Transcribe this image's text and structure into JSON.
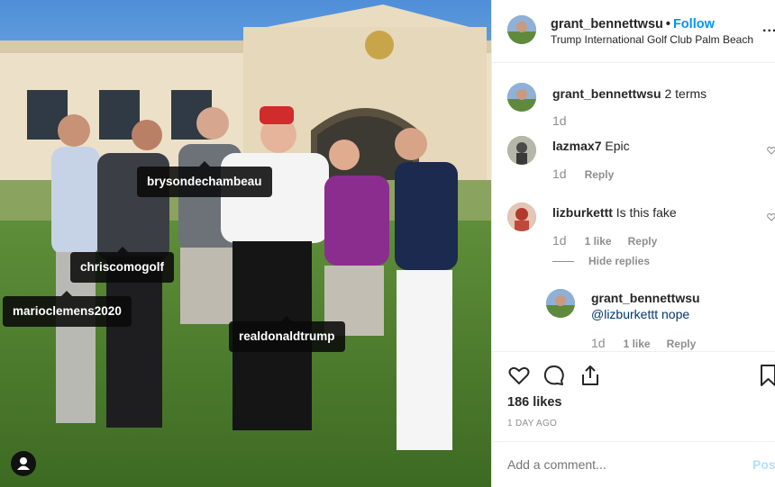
{
  "post": {
    "username": "grant_bennettwsu",
    "dot": "•",
    "follow_label": "Follow",
    "location": "Trump International Golf Club Palm Beach",
    "more_label": "..."
  },
  "photo": {
    "tags": [
      "brysondechambeau",
      "chriscomogolf",
      "marioclemens2020",
      "realdonaldtrump"
    ]
  },
  "comments": [
    {
      "username": "grant_bennettwsu",
      "text": "2 terms",
      "time": "1d"
    },
    {
      "username": "lazmax7",
      "text": "Epic",
      "time": "1d",
      "reply": "Reply"
    },
    {
      "username": "lizburkettt",
      "text": "Is this fake",
      "time": "1d",
      "likes": "1 like",
      "reply": "Reply",
      "hide_replies": "Hide replies"
    }
  ],
  "reply": {
    "username": "grant_bennettwsu",
    "text": "@lizburkettt nope",
    "time": "1d",
    "likes": "1 like",
    "reply": "Reply"
  },
  "likes_count": "186 likes",
  "post_date": "1 DAY AGO",
  "add_comment": {
    "placeholder": "Add a comment...",
    "post_label": "Post"
  },
  "icons": [
    "heart-icon",
    "comment-icon",
    "share-icon",
    "bookmark-icon",
    "user-tag-icon",
    "more-icon"
  ],
  "colors": {
    "accent": "#0095f6",
    "muted": "#8e8e8e",
    "post_disabled": "#b2dffc",
    "text": "#262626"
  }
}
